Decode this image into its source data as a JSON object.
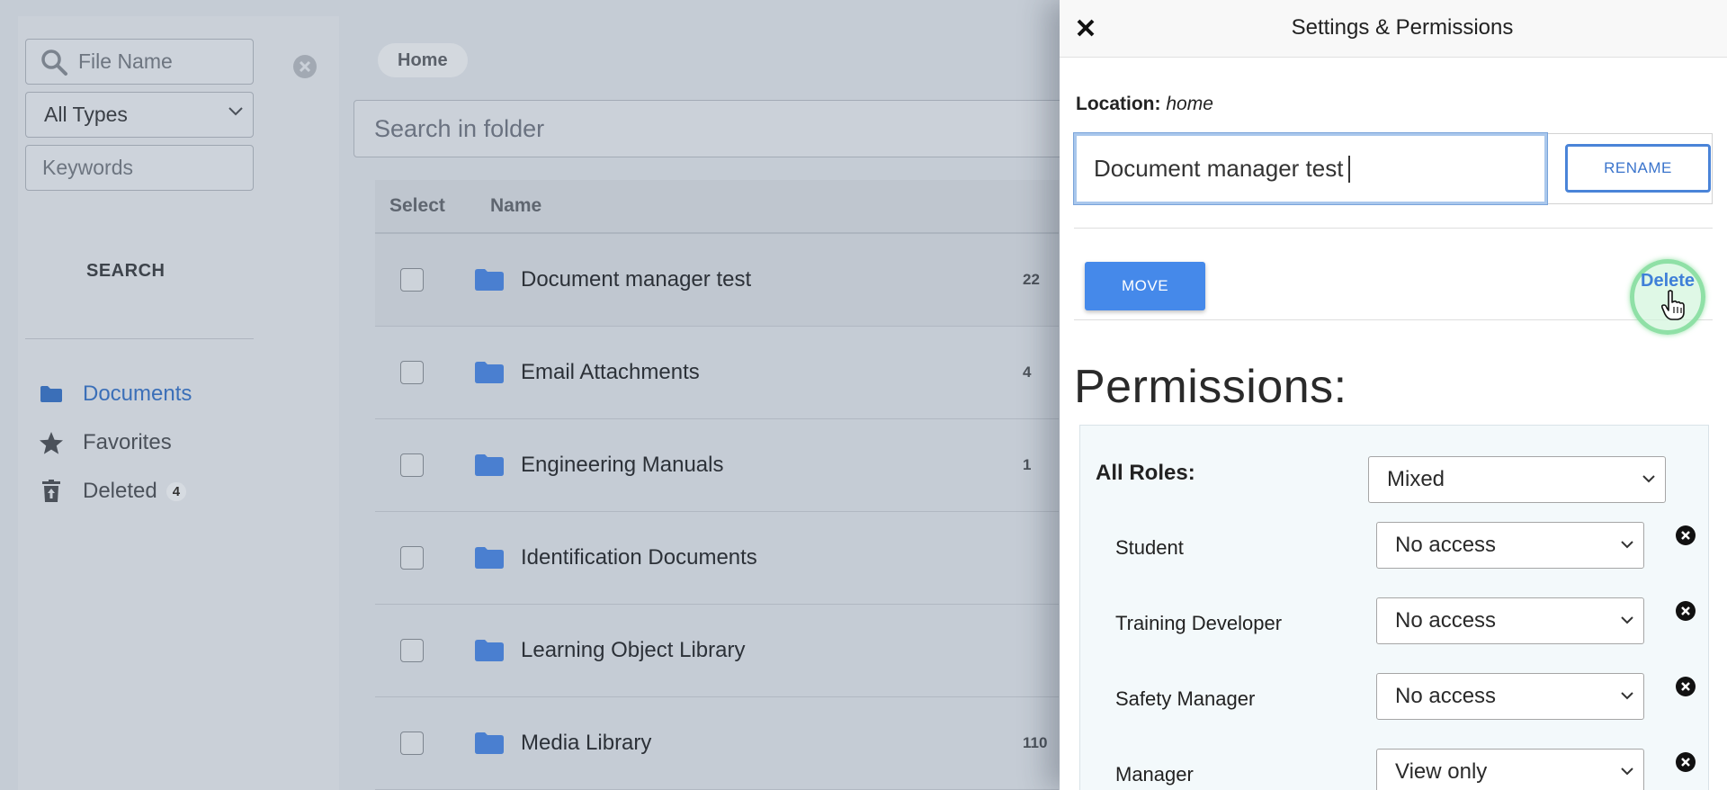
{
  "sidebar": {
    "filename_placeholder": "File Name",
    "type_select": "All Types",
    "keywords_placeholder": "Keywords",
    "search_label": "SEARCH",
    "nav": [
      {
        "label": "Documents",
        "icon": "folder-icon"
      },
      {
        "label": "Favorites",
        "icon": "star-icon"
      },
      {
        "label": "Deleted",
        "icon": "trash-icon",
        "badge": "4"
      }
    ]
  },
  "main": {
    "breadcrumb": "Home",
    "search_placeholder": "Search in folder",
    "columns": {
      "select": "Select",
      "name": "Name"
    },
    "rows": [
      {
        "name": "Document manager test",
        "count": "22"
      },
      {
        "name": "Email Attachments",
        "count": "4"
      },
      {
        "name": "Engineering Manuals",
        "count": "1"
      },
      {
        "name": "Identification Documents",
        "count": ""
      },
      {
        "name": "Learning Object Library",
        "count": ""
      },
      {
        "name": "Media Library",
        "count": "110"
      }
    ]
  },
  "panel": {
    "title": "Settings & Permissions",
    "location_label": "Location:",
    "location_value": "home",
    "name_value": "Document manager test",
    "rename_label": "RENAME",
    "move_label": "MOVE",
    "delete_label": "Delete",
    "permissions_title": "Permissions:",
    "all_roles_label": "All Roles:",
    "all_roles_value": "Mixed",
    "roles": [
      {
        "label": "Student",
        "value": "No access"
      },
      {
        "label": "Training Developer",
        "value": "No access"
      },
      {
        "label": "Safety Manager",
        "value": "No access"
      },
      {
        "label": "Manager",
        "value": "View only"
      }
    ]
  },
  "colors": {
    "accent": "#4589ea",
    "link": "#3b6fb8",
    "highlight_ring": "#8fe0a6"
  }
}
